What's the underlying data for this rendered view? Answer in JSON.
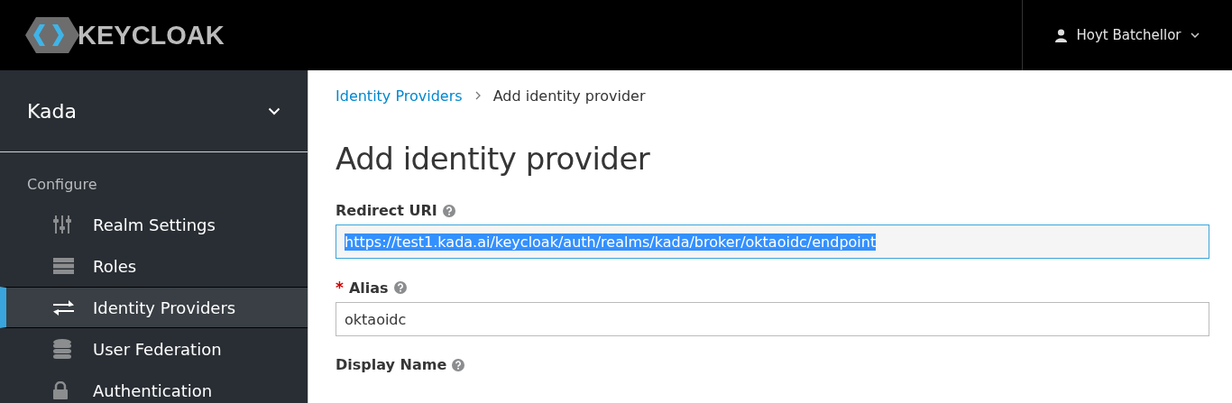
{
  "header": {
    "logo_text": "KEYCLOAK",
    "user": "Hoyt Batchellor"
  },
  "sidebar": {
    "realm": "Kada",
    "section": "Configure",
    "items": [
      {
        "label": "Realm Settings",
        "selected": false
      },
      {
        "label": "Roles",
        "selected": false
      },
      {
        "label": "Identity Providers",
        "selected": true
      },
      {
        "label": "User Federation",
        "selected": false
      },
      {
        "label": "Authentication",
        "selected": false
      }
    ]
  },
  "breadcrumb": [
    {
      "label": "Identity Providers",
      "kind": "link"
    },
    {
      "label": "Add identity provider",
      "kind": "current"
    }
  ],
  "title": "Add identity provider",
  "fields": [
    {
      "label": "Redirect URI",
      "value": "https://test1.kada.ai/keycloak/auth/realms/kada/broker/oktaoidc/endpoint",
      "readonly": true,
      "selected": true
    },
    {
      "label": "Alias",
      "required_mark": "*",
      "value": "oktaoidc",
      "readonly": false,
      "selected": false
    },
    {
      "label": "Display Name"
    }
  ]
}
